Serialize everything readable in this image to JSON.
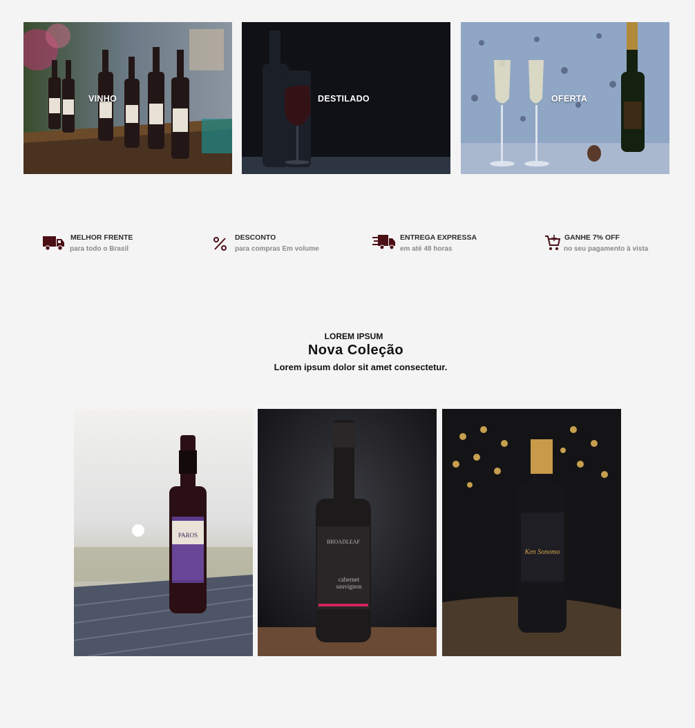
{
  "categories": [
    {
      "label": "VINHO"
    },
    {
      "label": "DESTILADO"
    },
    {
      "label": "OFERTA"
    }
  ],
  "features": [
    {
      "icon": "truck-icon",
      "title": "MELHOR FRENTE",
      "subtitle": "para todo o Brasil"
    },
    {
      "icon": "percent-icon",
      "title": "DESCONTO",
      "subtitle": "para compras Em volume"
    },
    {
      "icon": "fast-truck-icon",
      "title": "ENTREGA EXPRESSA",
      "subtitle": "em até 48 horas"
    },
    {
      "icon": "cart-icon",
      "title": "GANHE 7% OFF",
      "subtitle": "no seu pagamento à vista"
    }
  ],
  "collection": {
    "eyebrow": "LOREM IPSUM",
    "title": "Nova  Coleção",
    "subtitle": "Lorem ipsum dolor sit amet consectetur."
  },
  "products": [
    {
      "label_text": "PAROS"
    },
    {
      "label_text": "BROADLEAF",
      "label_text_2": "cabernet",
      "label_text_3": "sauvignon"
    },
    {
      "label_text": "Ken Sonomo"
    }
  ],
  "colors": {
    "icon": "#4a0f14",
    "page_bg": "#f4f4f4"
  }
}
